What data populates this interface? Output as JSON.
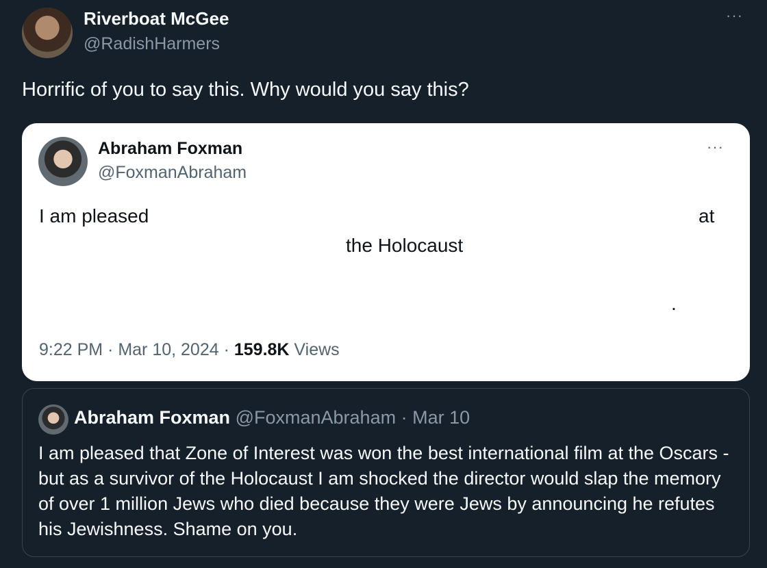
{
  "tweet": {
    "author": {
      "name": "Riverboat McGee",
      "handle": "@RadishHarmers"
    },
    "text": "Horrific of you to say this. Why would you say this?",
    "more_icon": "···"
  },
  "embedded_card": {
    "author": {
      "name": "Abraham Foxman",
      "handle": "@FoxmanAbraham"
    },
    "more_icon": "···",
    "text_fragments": [
      "I am pleased",
      "at",
      "the Holocaust",
      "."
    ],
    "timestamp": "9:22 PM · Mar 10, 2024 · ",
    "views_count": "159.8K",
    "views_label": " Views"
  },
  "quoted_tweet": {
    "author": {
      "name": "Abraham Foxman",
      "handle": "@FoxmanAbraham",
      "date": "· Mar 10"
    },
    "text": "I am pleased that Zone of Interest was won the best international film at the Oscars - but as a survivor of the Holocaust I am shocked the director would slap the memory of over 1 million Jews who died because they were Jews by announcing he refutes his Jewishness. Shame on you."
  }
}
